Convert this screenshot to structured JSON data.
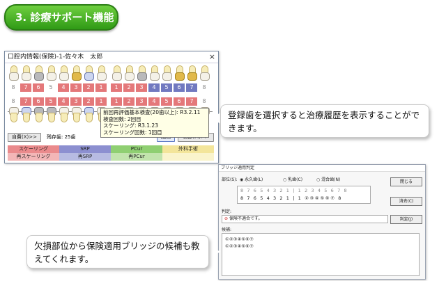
{
  "badge": {
    "title": "3. 診療サポート機能"
  },
  "chart_window": {
    "title": "口腔内情報(保険)-1-佐々木　太郎",
    "close": "×",
    "upper_numbers": [
      "8",
      "7",
      "6",
      "5",
      "4",
      "3",
      "2",
      "1",
      "1",
      "2",
      "3",
      "4",
      "5",
      "6",
      "7",
      "8"
    ],
    "lower_numbers": [
      "8",
      "7",
      "6",
      "5",
      "4",
      "3",
      "2",
      "1",
      "1",
      "2",
      "3",
      "4",
      "5",
      "6",
      "7",
      "8"
    ],
    "tooltip_lines": [
      "前回再評価基本検査(20歯以上): R3.2.11",
      "検査回数: 2回目",
      "スケーリング: R3.1.23",
      "スケーリング回数: 1回目"
    ],
    "btn_self": "自費(X)>>",
    "remaining": "残存歯: 25歯",
    "btn_color": "配色",
    "btn_init": "初診(M)>>",
    "legend": [
      "スケーリング",
      "SRP",
      "PCur",
      "外科手術",
      "再スケーリング",
      "再SRP",
      "再PCur",
      ""
    ]
  },
  "callout_top": {
    "text": "登録歯を選択すると治療履歴を表示することができます。"
  },
  "callout_bottom": {
    "text": "欠損部位から保険適用ブリッジの候補も教えてくれます。"
  },
  "bridge_window": {
    "title": "ブリッジ適用判定",
    "site_label": "部位(S):",
    "radio1": "永久歯(L)",
    "radio2": "乳歯(C)",
    "radio3": "混合歯(N)",
    "upper_row": "8 7 6 5 4 3 2 1 | 1 2 3 4 5 6 7 8",
    "lower_row": "8 7 6 5 4 3 2 1 | 1 ②③④⑤⑥⑦ 8",
    "btn_close": "閉じる",
    "btn_clear": "消去(C)",
    "judge_label": "判定:",
    "judge_value": "保険不適合です。",
    "btn_judge": "判定(J)",
    "cand_label": "候補:",
    "cand1": "①②③④⑤⑥⑦",
    "cand2": "①②③④⑤⑥⑦"
  }
}
